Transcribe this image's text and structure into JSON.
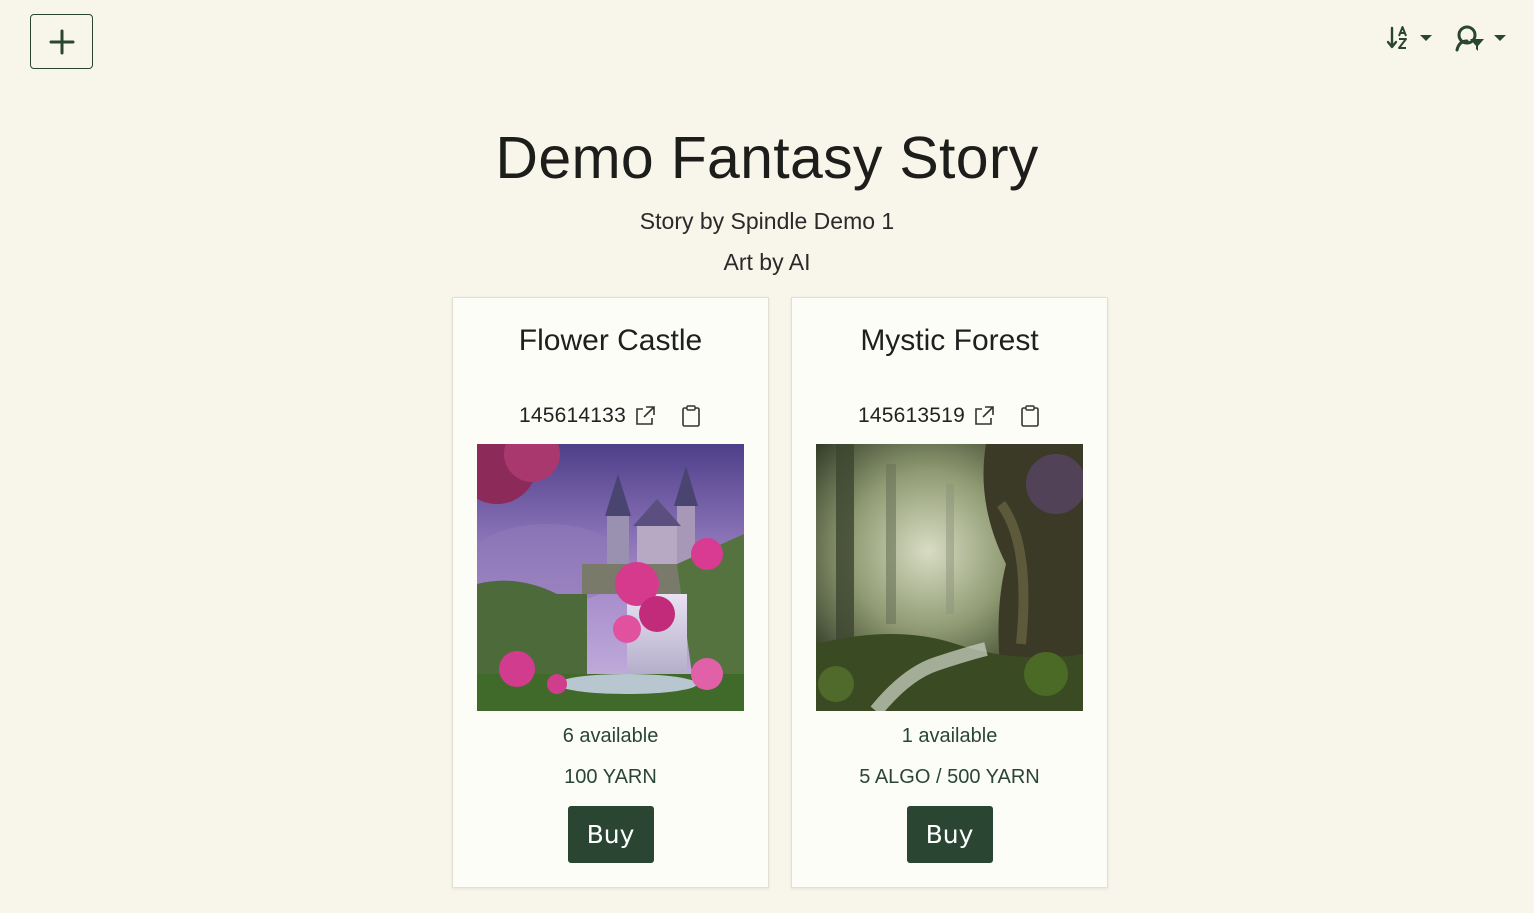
{
  "toolbar": {
    "add_icon": "plus-icon",
    "sort_icon": "sort-alpha-icon",
    "filter_icon": "user-filter-icon"
  },
  "header": {
    "title": "Demo Fantasy Story",
    "story_by": "Story by Spindle Demo 1",
    "art_by": "Art by AI"
  },
  "cards": [
    {
      "title": "Flower Castle",
      "asset_id": "145614133",
      "available": "6 available",
      "price": "100 YARN",
      "buy_label": "Buy"
    },
    {
      "title": "Mystic Forest",
      "asset_id": "145613519",
      "available": "1 available",
      "price": "5 ALGO / 500 YARN",
      "buy_label": "Buy"
    }
  ],
  "colors": {
    "background": "#f8f6ea",
    "accent": "#2a4632"
  }
}
